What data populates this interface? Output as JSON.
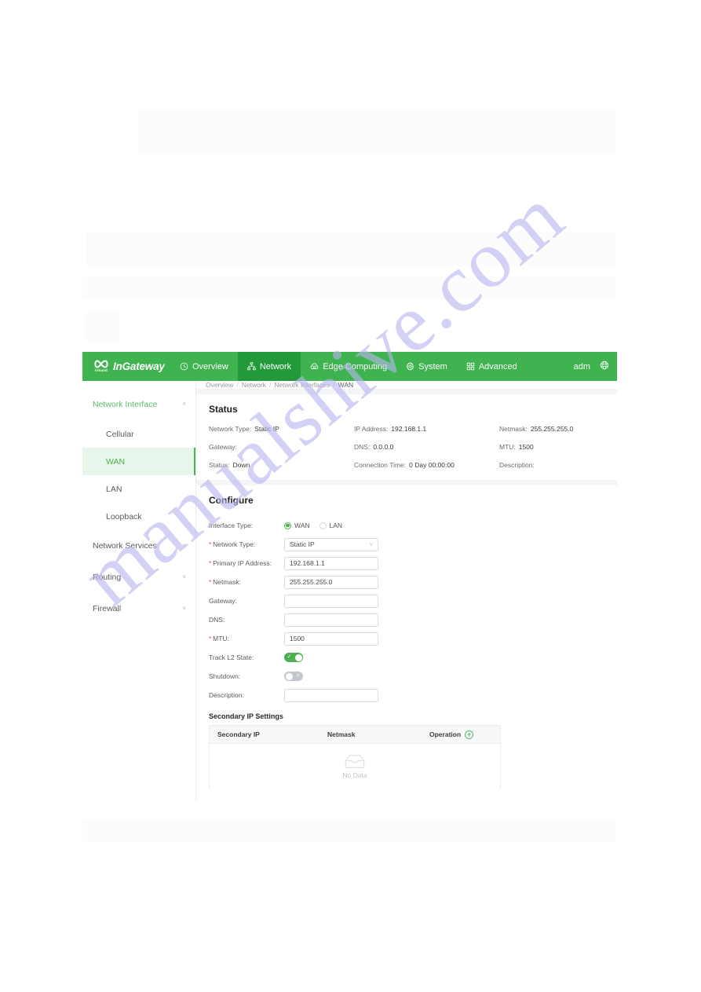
{
  "watermark": {
    "text": "manualshive.com"
  },
  "header": {
    "brand": {
      "name": "InGateway",
      "sub": "inhand",
      "logo_icon": "infinity-logo-icon"
    },
    "nav": [
      {
        "label": "Overview",
        "icon": "speedometer-icon",
        "active": false
      },
      {
        "label": "Network",
        "icon": "sitemap-icon",
        "active": true
      },
      {
        "label": "Edge Computing",
        "icon": "cloud-chip-icon",
        "active": false
      },
      {
        "label": "System",
        "icon": "gear-icon",
        "active": false
      },
      {
        "label": "Advanced",
        "icon": "grid-squares-icon",
        "active": false
      }
    ],
    "user": "adm",
    "language_icon": "globe-icon",
    "accent_color": "#3eb34f",
    "accent_active_color": "#229a3a"
  },
  "sidebar": {
    "groups": [
      {
        "label": "Network Interface",
        "expanded": true,
        "caret": "˄",
        "items": [
          {
            "label": "Cellular",
            "selected": false
          },
          {
            "label": "WAN",
            "selected": true
          },
          {
            "label": "LAN",
            "selected": false
          },
          {
            "label": "Loopback",
            "selected": false
          }
        ]
      },
      {
        "label": "Network Services",
        "expanded": false,
        "caret": "˅",
        "items": []
      },
      {
        "label": "Routing",
        "expanded": false,
        "caret": "˅",
        "items": []
      },
      {
        "label": "Firewall",
        "expanded": false,
        "caret": "˅",
        "items": []
      }
    ],
    "selected_color": "#4caf50"
  },
  "breadcrumb": {
    "items": [
      "Overview",
      "Network",
      "Network Interfaces",
      "WAN"
    ],
    "separator": "/"
  },
  "status": {
    "title": "Status",
    "fields": [
      {
        "key": "Network Type:",
        "value": "Static IP"
      },
      {
        "key": "IP Address:",
        "value": "192.168.1.1"
      },
      {
        "key": "Netmask:",
        "value": "255.255.255.0"
      },
      {
        "key": "Gateway:",
        "value": ""
      },
      {
        "key": "DNS:",
        "value": "0.0.0.0"
      },
      {
        "key": "MTU:",
        "value": "1500"
      },
      {
        "key": "Status:",
        "value": "Down"
      },
      {
        "key": "Connection Time:",
        "value": "0 Day 00:00:00"
      },
      {
        "key": "Description:",
        "value": ""
      }
    ]
  },
  "configure": {
    "title": "Configure",
    "interface_type": {
      "label": "Interface Type:",
      "options": [
        {
          "label": "WAN",
          "selected": true
        },
        {
          "label": "LAN",
          "selected": false
        }
      ]
    },
    "network_type": {
      "label": "Network Type:",
      "required": true,
      "value": "Static IP",
      "chevron": "˅"
    },
    "primary_ip": {
      "label": "Primary IP Address:",
      "required": true,
      "value": "192.168.1.1"
    },
    "netmask": {
      "label": "Netmask:",
      "required": true,
      "value": "255.255.255.0"
    },
    "gateway": {
      "label": "Gateway:",
      "required": false,
      "value": ""
    },
    "dns": {
      "label": "DNS:",
      "required": false,
      "value": ""
    },
    "mtu": {
      "label": "MTU:",
      "required": true,
      "value": "1500"
    },
    "track_l2": {
      "label": "Track L2 State:",
      "on": true,
      "mark": "✓"
    },
    "shutdown": {
      "label": "Shutdown:",
      "on": false,
      "mark": "✕"
    },
    "description": {
      "label": "Description:",
      "required": false,
      "value": ""
    }
  },
  "secondary_ip": {
    "title": "Secondary IP Settings",
    "columns": [
      "Secondary IP",
      "Netmask",
      "Operation"
    ],
    "add_icon": "plus-circle-icon",
    "add_symbol": "+",
    "rows": [],
    "empty_text": "No Data",
    "empty_icon": "empty-box-icon"
  }
}
